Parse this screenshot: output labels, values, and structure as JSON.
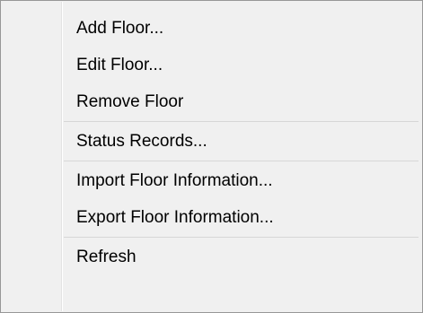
{
  "menu": {
    "items": [
      {
        "label": "Add Floor..."
      },
      {
        "label": "Edit Floor..."
      },
      {
        "label": "Remove Floor"
      },
      {
        "label": "Status Records..."
      },
      {
        "label": "Import Floor Information..."
      },
      {
        "label": "Export Floor Information..."
      },
      {
        "label": "Refresh"
      }
    ]
  }
}
